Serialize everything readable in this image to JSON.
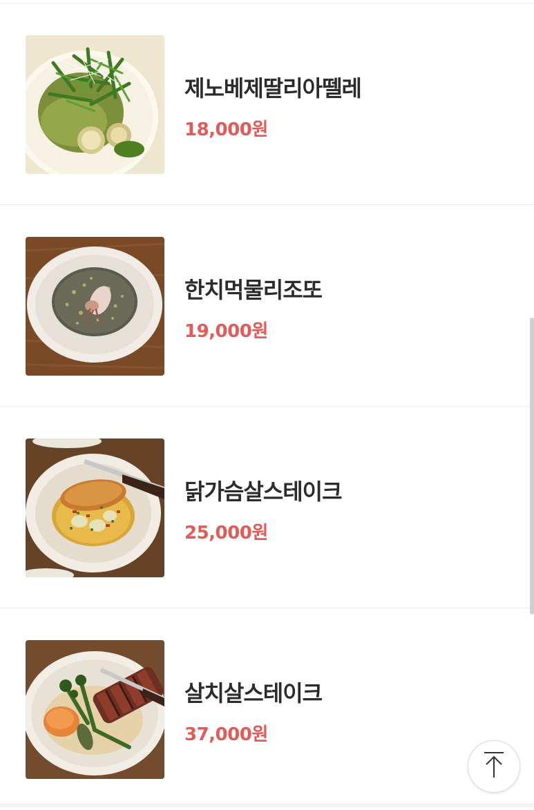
{
  "menu": {
    "items": [
      {
        "name": "제노베제딸리아뗄레",
        "price": "18,000원",
        "image": "pesto-pasta-with-arugula-and-shrimp"
      },
      {
        "name": "한치먹물리조또",
        "price": "19,000원",
        "image": "squid-ink-risotto-with-squid"
      },
      {
        "name": "닭가슴살스테이크",
        "price": "25,000원",
        "image": "chicken-breast-steak-with-potatoes"
      },
      {
        "name": "살치살스테이크",
        "price": "37,000원",
        "image": "sliced-beef-steak-with-broccolini-and-sweet-potato"
      }
    ]
  },
  "controls": {
    "scroll_top_icon": "arrow-up-icon"
  }
}
